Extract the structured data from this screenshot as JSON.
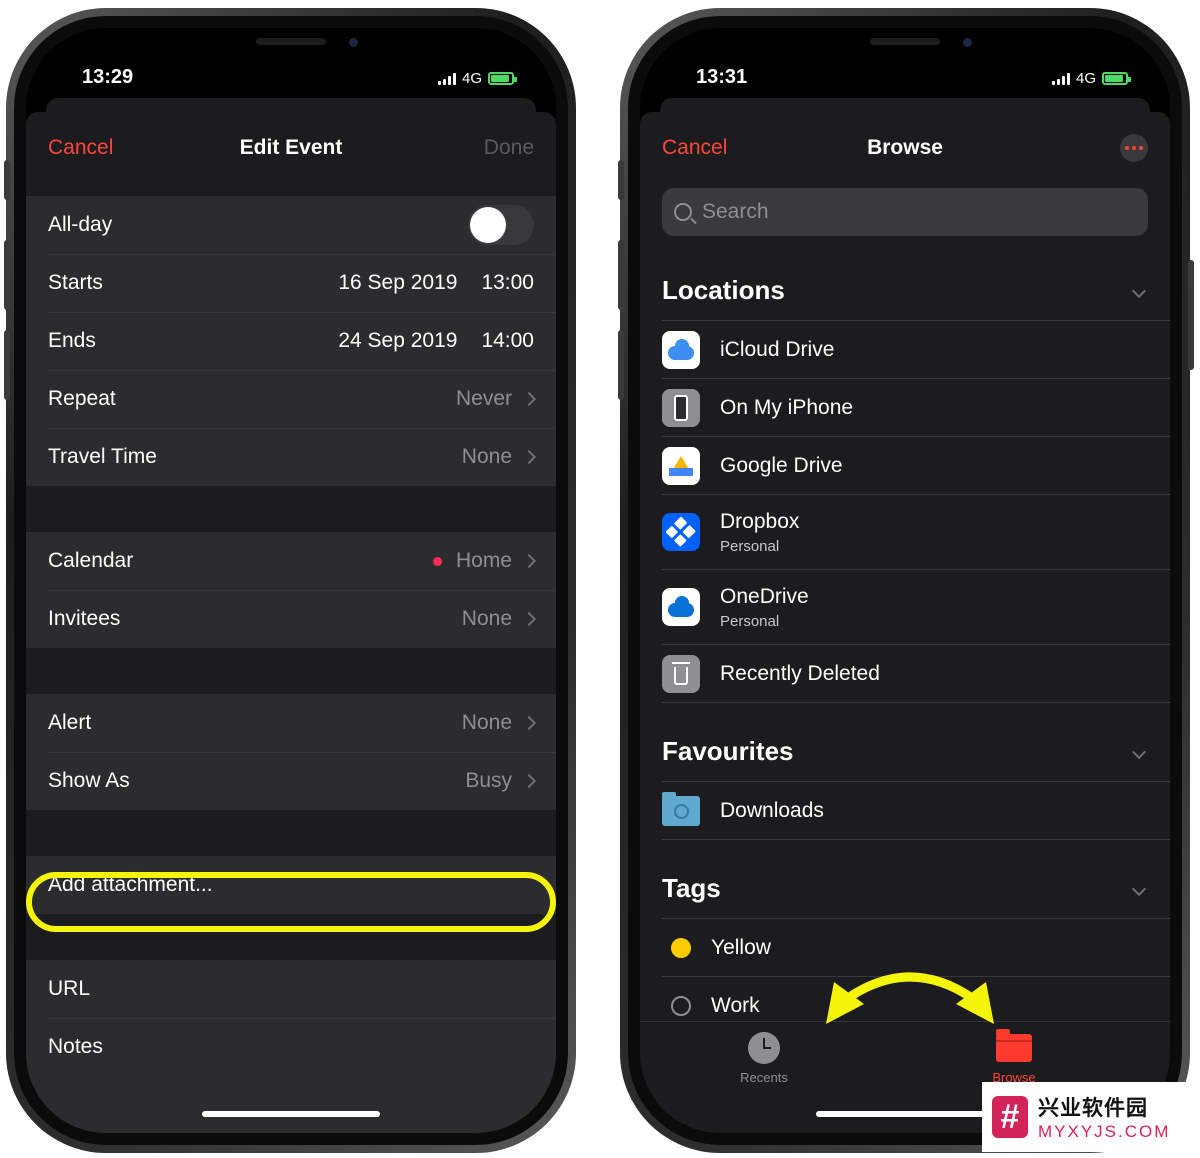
{
  "left_phone": {
    "status": {
      "time": "13:29",
      "network": "4G"
    },
    "nav": {
      "cancel": "Cancel",
      "title": "Edit Event",
      "done": "Done"
    },
    "rows": {
      "allday": "All-day",
      "starts_label": "Starts",
      "starts_date": "16 Sep 2019",
      "starts_time": "13:00",
      "ends_label": "Ends",
      "ends_date": "24 Sep 2019",
      "ends_time": "14:00",
      "repeat_label": "Repeat",
      "repeat_value": "Never",
      "travel_label": "Travel Time",
      "travel_value": "None",
      "calendar_label": "Calendar",
      "calendar_value": "Home",
      "invitees_label": "Invitees",
      "invitees_value": "None",
      "alert_label": "Alert",
      "alert_value": "None",
      "showas_label": "Show As",
      "showas_value": "Busy",
      "attachment": "Add attachment...",
      "url_placeholder": "URL",
      "notes_placeholder": "Notes"
    },
    "allday_toggle_on": false,
    "highlight_color": "#f5f50a"
  },
  "right_phone": {
    "status": {
      "time": "13:31",
      "network": "4G"
    },
    "nav": {
      "cancel": "Cancel",
      "title": "Browse"
    },
    "search_placeholder": "Search",
    "locations": {
      "heading": "Locations",
      "items": [
        {
          "title": "iCloud Drive",
          "icon": "icloud-drive-icon"
        },
        {
          "title": "On My iPhone",
          "icon": "iphone-icon"
        },
        {
          "title": "Google Drive",
          "icon": "google-drive-icon"
        },
        {
          "title": "Dropbox",
          "subtitle": "Personal",
          "icon": "dropbox-icon"
        },
        {
          "title": "OneDrive",
          "subtitle": "Personal",
          "icon": "onedrive-icon"
        },
        {
          "title": "Recently Deleted",
          "icon": "trash-icon"
        }
      ]
    },
    "favourites": {
      "heading": "Favourites",
      "items": [
        {
          "title": "Downloads",
          "icon": "downloads-folder-icon"
        }
      ]
    },
    "tags": {
      "heading": "Tags",
      "items": [
        {
          "title": "Yellow",
          "color": "#ffcc00"
        },
        {
          "title": "Work",
          "color": "none"
        }
      ]
    },
    "tabbar": {
      "recents": "Recents",
      "browse": "Browse"
    },
    "accent_color": "#ff453a"
  },
  "watermark": {
    "chinese": "兴业软件园",
    "english": "MYXYJS.COM"
  }
}
